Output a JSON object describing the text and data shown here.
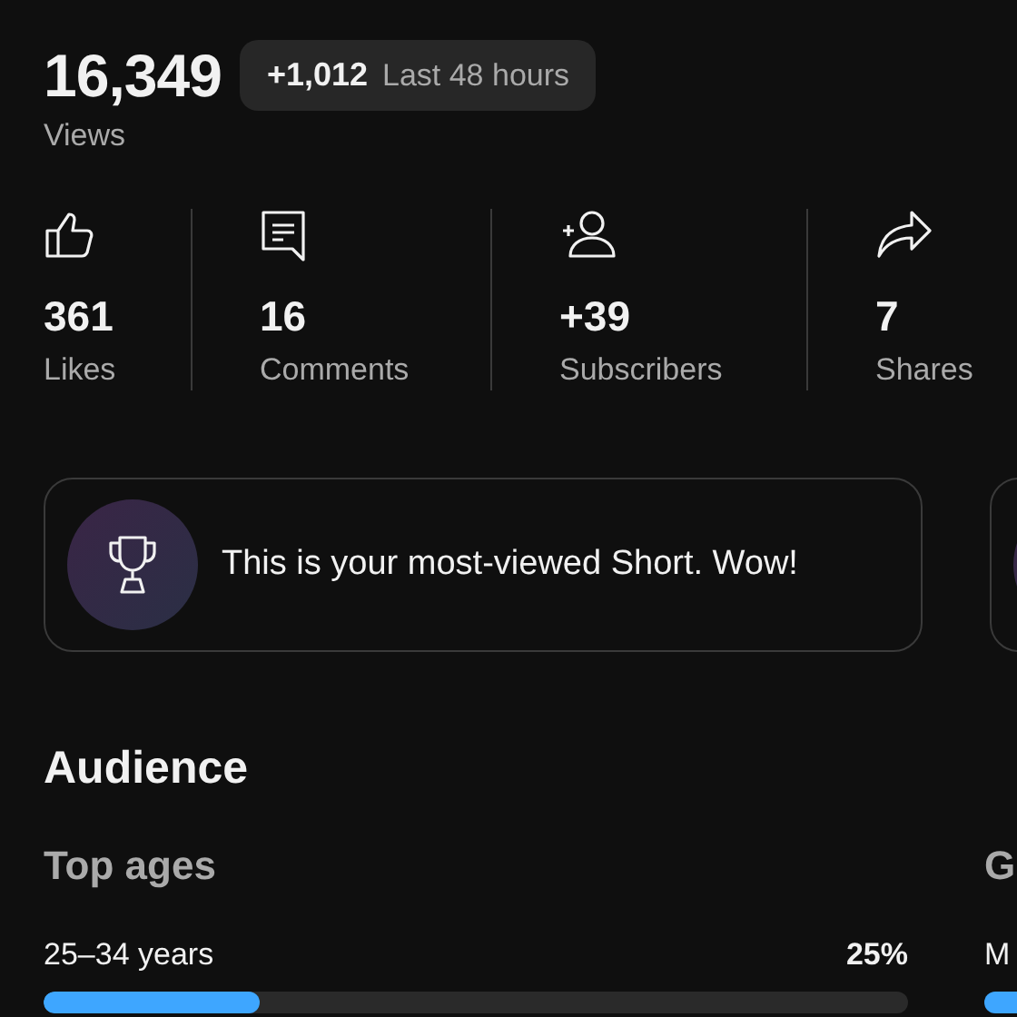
{
  "views": {
    "count": "16,349",
    "label": "Views",
    "delta": "+1,012",
    "period": "Last 48 hours"
  },
  "stats": [
    {
      "kind": "likes",
      "value": "361",
      "label": "Likes"
    },
    {
      "kind": "comments",
      "value": "16",
      "label": "Comments"
    },
    {
      "kind": "subscribers",
      "value": "+39",
      "label": "Subscribers"
    },
    {
      "kind": "shares",
      "value": "7",
      "label": "Shares"
    }
  ],
  "highlights": [
    {
      "kind": "trophy",
      "text": "This is your most-viewed Short. Wow!"
    },
    {
      "kind": "partial"
    }
  ],
  "audience": {
    "title": "Audience",
    "sections": [
      {
        "title": "Top ages",
        "rows": [
          {
            "label": "25–34 years",
            "value": "25%",
            "level": 0.25
          }
        ]
      },
      {
        "title": "G",
        "rows": [
          {
            "label": "M"
          }
        ]
      }
    ]
  }
}
